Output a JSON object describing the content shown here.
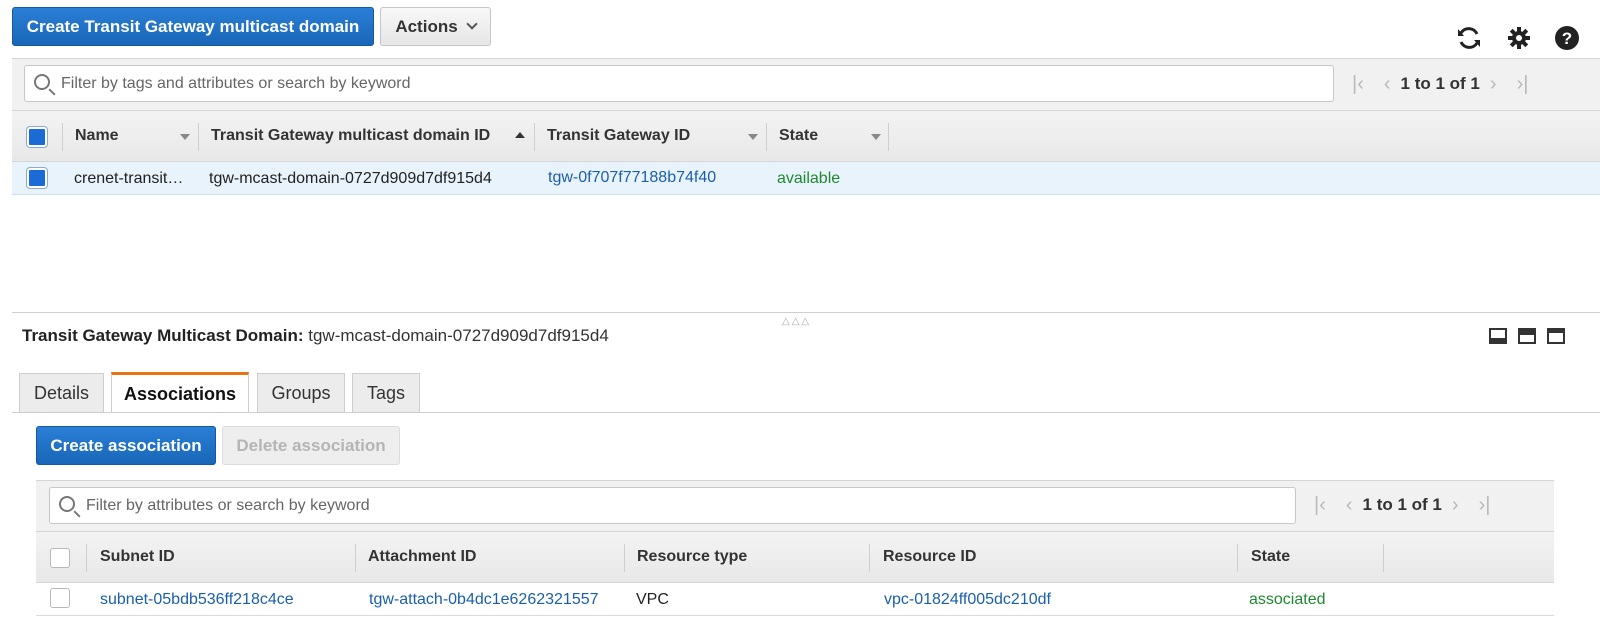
{
  "toolbar": {
    "create_label": "Create Transit Gateway multicast domain",
    "actions_label": "Actions"
  },
  "top_icons": [
    "refresh-icon",
    "gear-icon",
    "help-icon"
  ],
  "top_table": {
    "search_placeholder": "Filter by tags and attributes or search by keyword",
    "pager_text": "1 to 1 of 1",
    "headers": {
      "name": "Name",
      "domain_id": "Transit Gateway multicast domain ID",
      "tgw_id": "Transit Gateway ID",
      "state": "State"
    },
    "row": {
      "name": "crenet-transit…",
      "domain_id": "tgw-mcast-domain-0727d909d7df915d4",
      "tgw_id": "tgw-0f707f77188b74f40",
      "state": "available"
    }
  },
  "detail": {
    "title_label": "Transit Gateway Multicast Domain:",
    "title_value": "tgw-mcast-domain-0727d909d7df915d4",
    "tabs": {
      "details": "Details",
      "associations": "Associations",
      "groups": "Groups",
      "tags": "Tags"
    },
    "create_association": "Create association",
    "delete_association": "Delete association"
  },
  "assoc_table": {
    "search_placeholder": "Filter by attributes or search by keyword",
    "pager_text": "1 to 1 of 1",
    "headers": {
      "subnet_id": "Subnet ID",
      "attachment_id": "Attachment ID",
      "resource_type": "Resource type",
      "resource_id": "Resource ID",
      "state": "State"
    },
    "row": {
      "subnet_id": "subnet-05bdb536ff218c4ce",
      "attachment_id": "tgw-attach-0b4dc1e6262321557",
      "resource_type": "VPC",
      "resource_id": "vpc-01824ff005dc210df",
      "state": "associated"
    }
  },
  "colors": {
    "primary": "#1866b8",
    "link": "#1a5fae",
    "success": "#1e8a2e",
    "active_tab": "#ec7211",
    "selected_row": "#e9f3fc"
  }
}
